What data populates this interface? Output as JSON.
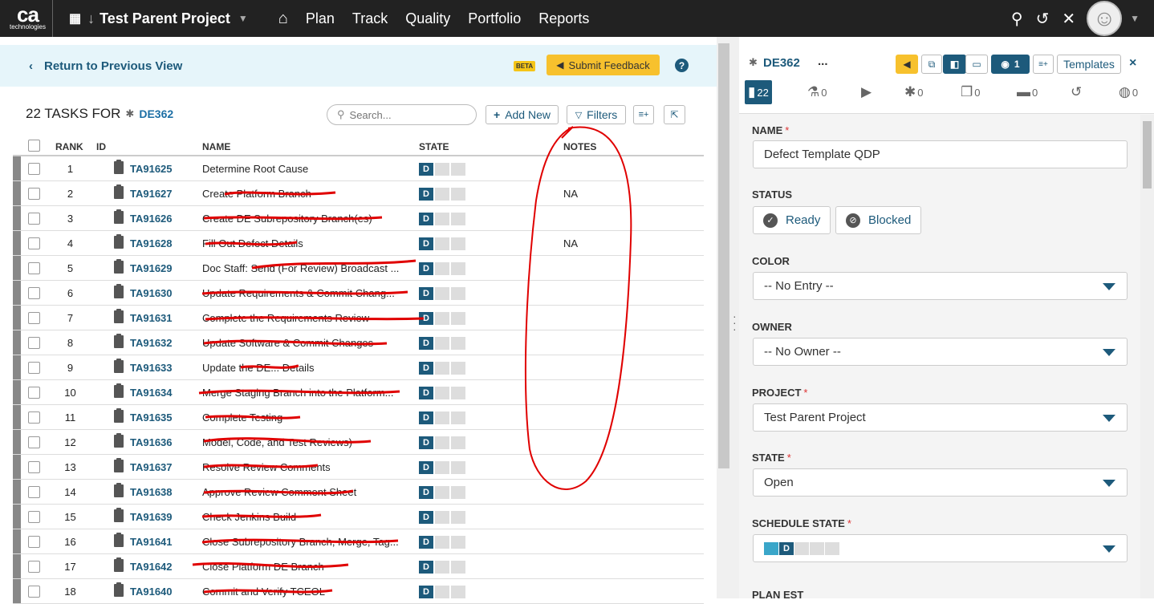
{
  "nav": {
    "logo_text": "ca",
    "logo_sub": "technologies",
    "project_name": "Test Parent Project",
    "links": [
      "Plan",
      "Track",
      "Quality",
      "Portfolio",
      "Reports"
    ]
  },
  "toolbar": {
    "return_label": "Return to Previous View",
    "beta_label": "BETA",
    "feedback_label": "Submit Feedback",
    "help_label": "?"
  },
  "tasks": {
    "header_prefix": "22 TASKS FOR",
    "defect_id": "DE362",
    "search_placeholder": "Search...",
    "add_new_label": "Add New",
    "filters_label": "Filters",
    "columns": {
      "rank": "RANK",
      "id": "ID",
      "name": "NAME",
      "state": "STATE",
      "notes": "NOTES"
    },
    "rows": [
      {
        "rank": "1",
        "id": "TA91625",
        "name": "Determine Root Cause",
        "state": "D",
        "notes": ""
      },
      {
        "rank": "2",
        "id": "TA91627",
        "name": "Create Platform Branch",
        "state": "D",
        "notes": "NA"
      },
      {
        "rank": "3",
        "id": "TA91626",
        "name": "Create DE Subrepository Branch(es)",
        "state": "D",
        "notes": ""
      },
      {
        "rank": "4",
        "id": "TA91628",
        "name": "Fill Out Defect Details",
        "state": "D",
        "notes": "NA"
      },
      {
        "rank": "5",
        "id": "TA91629",
        "name": "Doc Staff: Send (For Review) Broadcast ...",
        "state": "D",
        "notes": ""
      },
      {
        "rank": "6",
        "id": "TA91630",
        "name": "Update Requirements & Commit Chang...",
        "state": "D",
        "notes": ""
      },
      {
        "rank": "7",
        "id": "TA91631",
        "name": "Complete the Requirements Review",
        "state": "D",
        "notes": ""
      },
      {
        "rank": "8",
        "id": "TA91632",
        "name": "Update Software & Commit Changes",
        "state": "D",
        "notes": ""
      },
      {
        "rank": "9",
        "id": "TA91633",
        "name": "Update the DE... Details",
        "state": "D",
        "notes": ""
      },
      {
        "rank": "10",
        "id": "TA91634",
        "name": "Merge Staging Branch into the Platform...",
        "state": "D",
        "notes": ""
      },
      {
        "rank": "11",
        "id": "TA91635",
        "name": "Complete Testing",
        "state": "D",
        "notes": ""
      },
      {
        "rank": "12",
        "id": "TA91636",
        "name": "Model, Code, and Test Reviews)",
        "state": "D",
        "notes": ""
      },
      {
        "rank": "13",
        "id": "TA91637",
        "name": "Resolve Review Comments",
        "state": "D",
        "notes": ""
      },
      {
        "rank": "14",
        "id": "TA91638",
        "name": "Approve Review Comment Sheet",
        "state": "D",
        "notes": ""
      },
      {
        "rank": "15",
        "id": "TA91639",
        "name": "Check Jenkins Build",
        "state": "D",
        "notes": ""
      },
      {
        "rank": "16",
        "id": "TA91641",
        "name": "Close Subrepository Branch, Merge, Tag...",
        "state": "D",
        "notes": ""
      },
      {
        "rank": "17",
        "id": "TA91642",
        "name": "Close Platform DE Branch",
        "state": "D",
        "notes": ""
      },
      {
        "rank": "18",
        "id": "TA91640",
        "name": "Commit and Verify TCEOL",
        "state": "D",
        "notes": ""
      }
    ]
  },
  "detail": {
    "id": "DE362",
    "more_label": "...",
    "watchers_count": "1",
    "templates_label": "Templates",
    "close_label": "×",
    "tabs": [
      {
        "icon": "tasks-icon",
        "count": "22"
      },
      {
        "icon": "flask-icon",
        "count": "0"
      },
      {
        "icon": "play-icon",
        "count": ""
      },
      {
        "icon": "defect-icon",
        "count": "0"
      },
      {
        "icon": "copies-icon",
        "count": "0"
      },
      {
        "icon": "discussion-icon",
        "count": "0"
      },
      {
        "icon": "history-icon",
        "count": ""
      },
      {
        "icon": "globe-icon",
        "count": "0"
      }
    ],
    "name_label": "NAME",
    "name_value": "Defect Template QDP",
    "status_label": "STATUS",
    "ready_label": "Ready",
    "blocked_label": "Blocked",
    "color_label": "COLOR",
    "color_value": "-- No Entry --",
    "owner_label": "OWNER",
    "owner_value": "-- No Owner --",
    "project_label": "PROJECT",
    "project_value": "Test Parent Project",
    "state_label": "STATE",
    "state_value": "Open",
    "schedule_state_label": "SCHEDULE STATE",
    "schedule_state_value": "D",
    "plan_est_label": "PLAN EST"
  },
  "colors": {
    "nav_bg": "#222222",
    "accent": "#1d5a7b",
    "feedback": "#f7c12d",
    "return_bar": "#e6f5fa",
    "annotation": "#e00000"
  }
}
